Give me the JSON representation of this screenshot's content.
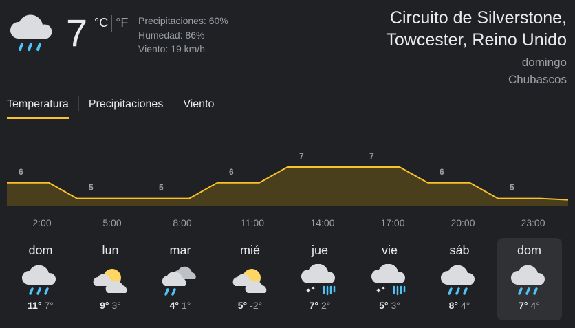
{
  "current": {
    "temperature": "7",
    "unit_c": "°C",
    "unit_f": "°F",
    "icon": "rain-cloud-icon",
    "precipitation": "Precipitaciones: 60%",
    "humidity": "Humedad: 86%",
    "wind": "Viento: 19 km/h"
  },
  "location": {
    "line1": "Circuito de Silverstone,",
    "line2": "Towcester, Reino Unido",
    "day": "domingo",
    "condition": "Chubascos"
  },
  "tabs": [
    {
      "label": "Temperatura",
      "active": true
    },
    {
      "label": "Precipitaciones",
      "active": false
    },
    {
      "label": "Viento",
      "active": false
    }
  ],
  "chart_data": {
    "type": "area",
    "x": [
      "2:00",
      "5:00",
      "8:00",
      "11:00",
      "14:00",
      "17:00",
      "20:00",
      "23:00"
    ],
    "values": [
      6,
      5,
      5,
      6,
      7,
      7,
      6,
      5
    ],
    "data_labels": [
      "6",
      "5",
      "5",
      "6",
      "7",
      "7",
      "6",
      "5"
    ],
    "line_color": "#fbc02d",
    "fill_color": "#4a3f1c",
    "grid": false
  },
  "forecast": [
    {
      "day": "dom",
      "hi": "11°",
      "lo": "7°",
      "icon": "rain-cloud-icon",
      "selected": false
    },
    {
      "day": "lun",
      "hi": "9°",
      "lo": "3°",
      "icon": "partly-sunny-icon",
      "selected": false
    },
    {
      "day": "mar",
      "hi": "4°",
      "lo": "1°",
      "icon": "rain-clouds-icon",
      "selected": false
    },
    {
      "day": "mié",
      "hi": "5°",
      "lo": "-2°",
      "icon": "partly-sunny-icon",
      "selected": false
    },
    {
      "day": "jue",
      "hi": "7°",
      "lo": "2°",
      "icon": "snow-rain-icon",
      "selected": false
    },
    {
      "day": "vie",
      "hi": "5°",
      "lo": "3°",
      "icon": "snow-rain-icon",
      "selected": false
    },
    {
      "day": "sáb",
      "hi": "8°",
      "lo": "4°",
      "icon": "rain-cloud-icon",
      "selected": false
    },
    {
      "day": "dom",
      "hi": "7°",
      "lo": "4°",
      "icon": "rain-cloud-icon",
      "selected": true
    }
  ],
  "colors": {
    "background": "#202124",
    "accent": "#fbc02d",
    "rain": "#4fc3f7",
    "sun": "#fdd663"
  }
}
